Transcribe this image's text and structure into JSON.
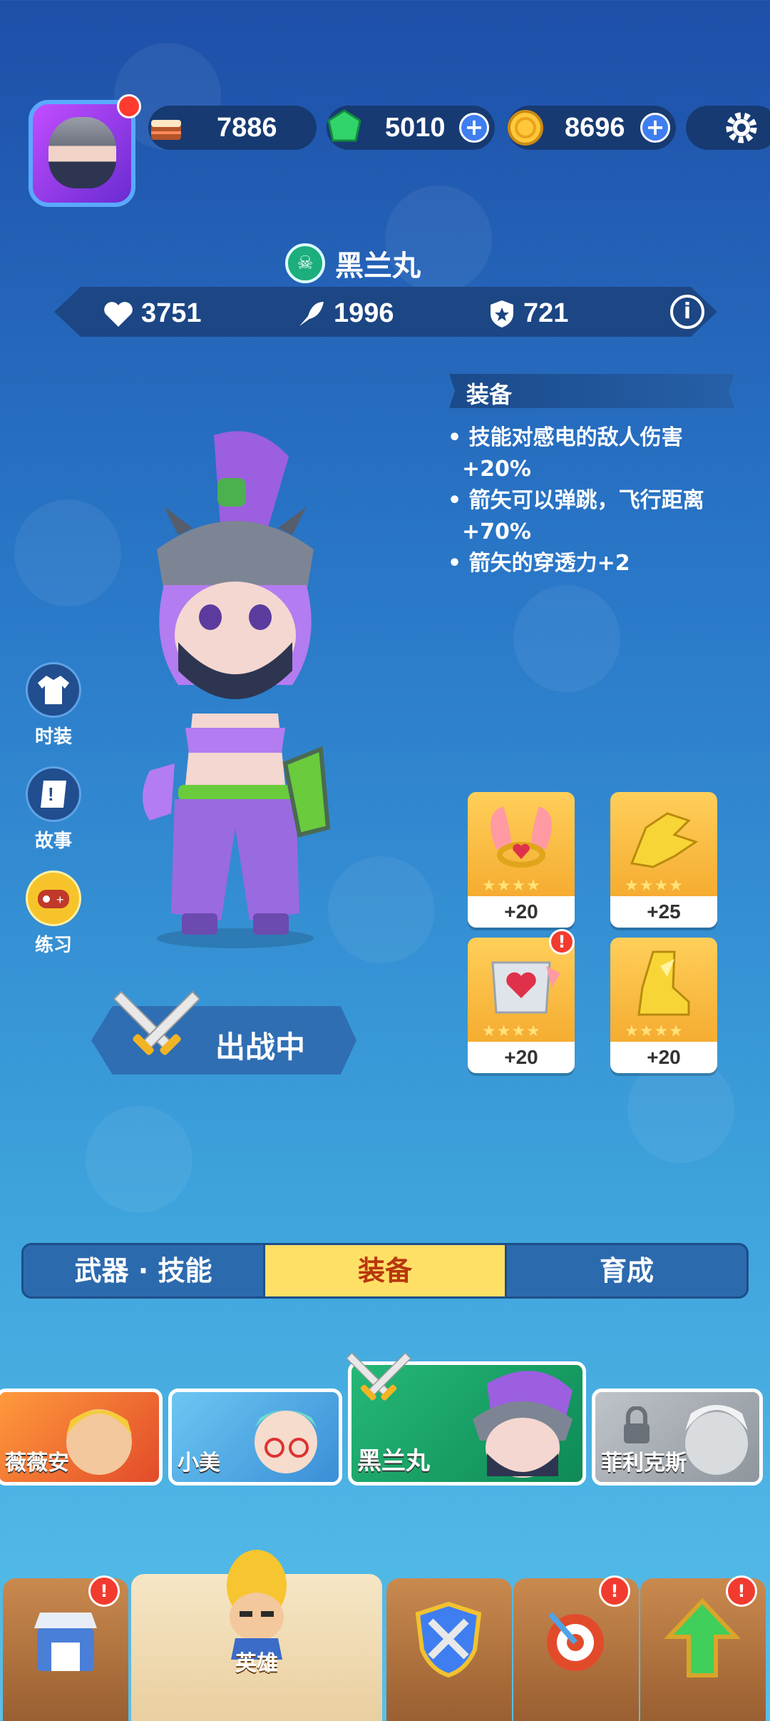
{
  "resources": {
    "cake": "7886",
    "gems": "5010",
    "coins": "8696"
  },
  "hero": {
    "name": "黑兰丸",
    "health": "3751",
    "attack": "1996",
    "defense": "721"
  },
  "equipment_panel": {
    "title": "装备",
    "lines": [
      "• 技能对感电的敌人伤害",
      "+20%",
      "• 箭矢可以弹跳，飞行距离",
      "+70%",
      "• 箭矢的穿透力+2"
    ]
  },
  "side_buttons": {
    "costume": "时装",
    "story": "故事",
    "practice": "练习"
  },
  "deploy_label": "出战中",
  "equip_cards": [
    {
      "value": "+20",
      "icon": "winged-ring-icon"
    },
    {
      "value": "+25",
      "icon": "golden-gauntlet-icon"
    },
    {
      "value": "+20",
      "icon": "heart-armor-icon"
    },
    {
      "value": "+20",
      "icon": "golden-boot-icon"
    }
  ],
  "tabs": [
    "武器 · 技能",
    "装备",
    "育成"
  ],
  "active_tab": "装备",
  "roster": [
    "薇薇安",
    "小美",
    "黑兰丸",
    "菲利克斯"
  ],
  "bottom_nav": {
    "heroes": "英雄"
  },
  "colors": {
    "accent_yellow": "#ffe066",
    "badge_red": "#f23b2f",
    "selected_hero_green": "#1ea36a"
  }
}
